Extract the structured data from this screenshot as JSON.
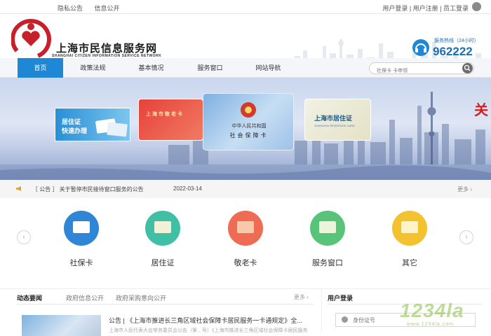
{
  "topbar": {
    "left_links": [
      "隐私公告",
      "信息公开"
    ],
    "right_links": "用户登录 | 用户注册 | 员工登录"
  },
  "header": {
    "title": "上海市民信息服务网",
    "subtitle": "SHANGHAI CITIZEN INFORMATION SERVICE NETWORK",
    "hotline_label": "服务热线（24小时）",
    "hotline_number": "962222"
  },
  "nav": {
    "items": [
      "首页",
      "政策法规",
      "基本情况",
      "服务窗口",
      "网站导航"
    ],
    "search_placeholder": "社保卡 卡申领"
  },
  "banner": {
    "card1_title": "居住证",
    "card1_sub": "快速办理",
    "card2_title": "上海市敬老卡",
    "card3_line1": "中华人民共和国",
    "card3_line2": "社会保障卡",
    "card4_title": "上海市居住证",
    "card4_sub": "SHANGHAI RESIDENCE CARD",
    "edge_text": "关"
  },
  "notice": {
    "text": "［ 公告 ］ 关于暂停市民接待窗口服务的公告",
    "date": "2022-03-14",
    "more": "更多 ›"
  },
  "services": {
    "items": [
      {
        "label": "社保卡",
        "color": "#2f86d6"
      },
      {
        "label": "居住证",
        "color": "#3fc0a4"
      },
      {
        "label": "敬老卡",
        "color": "#ef6b54"
      },
      {
        "label": "服务窗口",
        "color": "#57c47a"
      },
      {
        "label": "其它",
        "color": "#f4c12f"
      }
    ],
    "prev": "‹",
    "next": "›"
  },
  "news": {
    "tabs": [
      "动态要闻",
      "政府信息公开",
      "政府采购意向公开"
    ],
    "more": "更多 ›",
    "headline": "公告 | 《上海市推进长三角区域社会保障卡居民服务一卡通规定》全...",
    "summary": "上海市人民代表大会常务委员会公告（第…号）《上海市推进长三角区域社会保障卡居民服务"
  },
  "login": {
    "title": "用户登录",
    "id_placeholder": "身份证号"
  },
  "watermark": {
    "main": "1234la",
    "sub": "www.1234la.com"
  }
}
